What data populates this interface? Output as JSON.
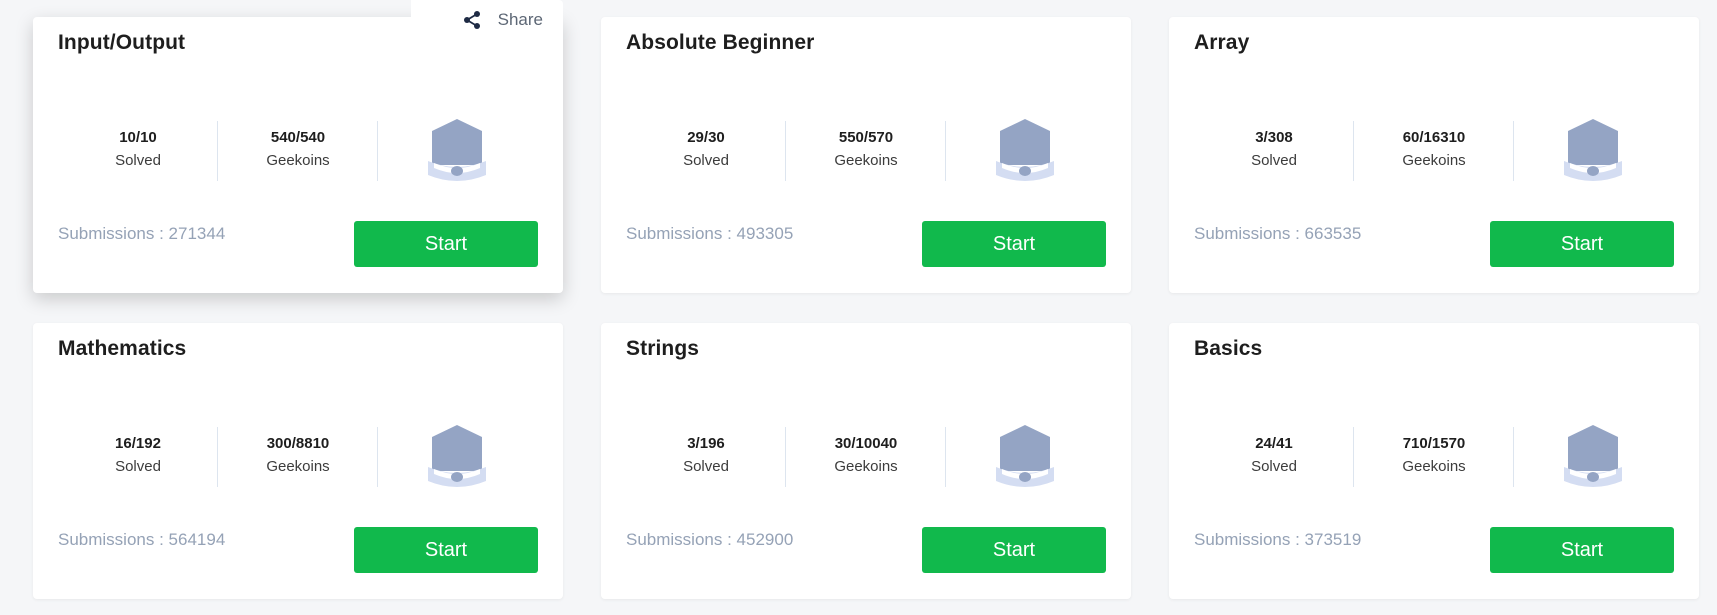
{
  "share": {
    "label": "Share",
    "icon": "share-icon"
  },
  "labels": {
    "solved": "Solved",
    "geekoins": "Geekoins",
    "start": "Start"
  },
  "colors": {
    "accent": "#11b94c",
    "badge": "#94a4c4",
    "muted": "#95a2b6"
  },
  "cards": [
    {
      "title": "Input/Output",
      "solved": "10/10",
      "geekoins": "540/540",
      "submissions": "Submissions : 271344"
    },
    {
      "title": "Absolute Beginner",
      "solved": "29/30",
      "geekoins": "550/570",
      "submissions": "Submissions : 493305"
    },
    {
      "title": "Array",
      "solved": "3/308",
      "geekoins": "60/16310",
      "submissions": "Submissions : 663535"
    },
    {
      "title": "Mathematics",
      "solved": "16/192",
      "geekoins": "300/8810",
      "submissions": "Submissions : 564194"
    },
    {
      "title": "Strings",
      "solved": "3/196",
      "geekoins": "30/10040",
      "submissions": "Submissions : 452900"
    },
    {
      "title": "Basics",
      "solved": "24/41",
      "geekoins": "710/1570",
      "submissions": "Submissions : 373519"
    }
  ]
}
